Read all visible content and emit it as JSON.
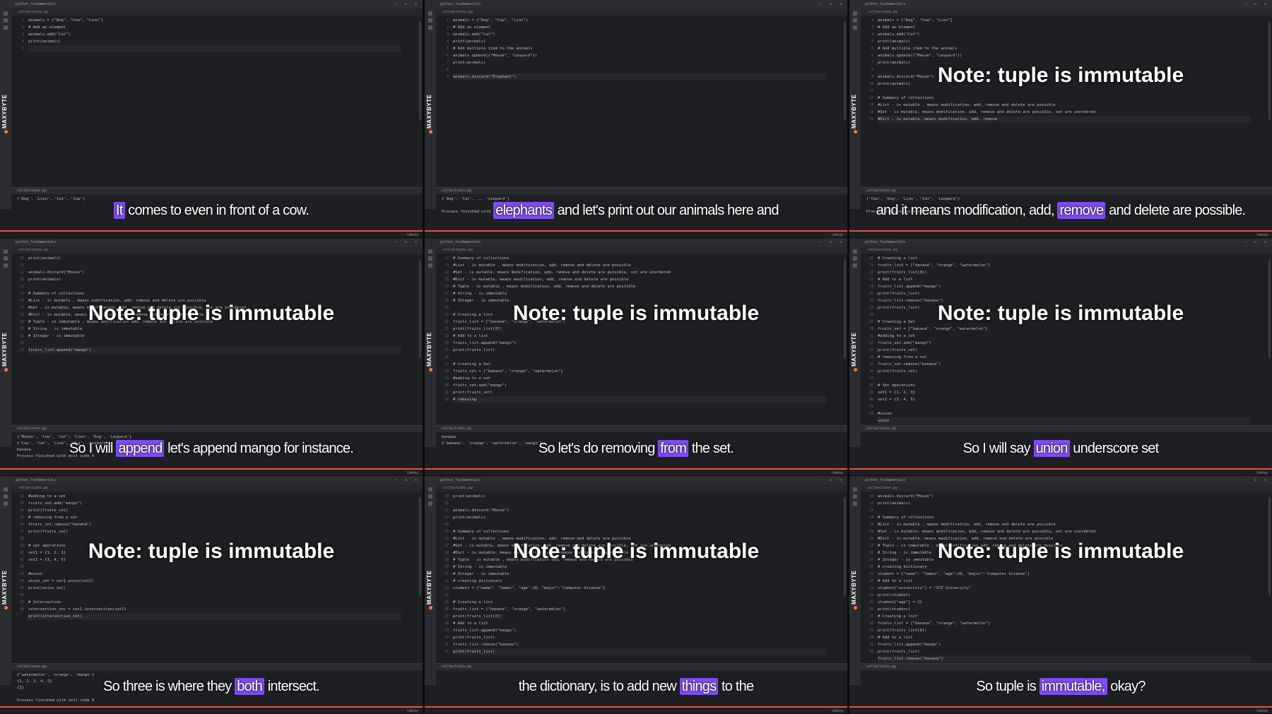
{
  "brand": "MAXYBYTE",
  "footer_label": "Udemy",
  "note_text": "Note: tuple is immutable",
  "panels": [
    {
      "title": "python_fundamentals",
      "tab": "collections.py",
      "gutter": "1\n2\n3\n4\n5",
      "code": [
        "animals = {\"Dog\", \"Cow\", \"Lion\"}",
        "# Add an element",
        "animals.add(\"Cat\")",
        "print(animals)",
        ""
      ],
      "output": "{'Dog', 'Lion', 'Cat', 'Cow'}",
      "note": false,
      "caption": {
        "before": "",
        "hl": "It",
        "after": " comes to even in front of a cow."
      }
    },
    {
      "title": "python_fundamentals",
      "tab": "collections.py",
      "gutter": "1\n2\n3\n4\n5\n6\n7\n8\n9",
      "code": [
        "animals = {\"Dog\", \"Cow\", \"Lion\"}",
        "# Add an element",
        "animals.add(\"Cat\")",
        "print(animals)",
        "# Add multiple item to the animals",
        "animals.update({\"Mouse\", \"Leopard\"})",
        "print(animals)",
        "",
        "animals.discard(\"Elephant\")"
      ],
      "output": "{'Dog', 'Cat', ... 'Leopard'}\n\nProcess finished with exit code 0",
      "note": false,
      "caption": {
        "before": "",
        "hl": "elephants",
        "after": " and let's print out our animals here and"
      }
    },
    {
      "title": "python_fundamentals",
      "tab": "collections.py",
      "gutter": "1\n2\n3\n4\n5\n6\n7\n8\n9\n10\n11\n12\n13\n14\n15",
      "code": [
        "animals = {\"Dog\", \"Cow\", \"Lion\"}",
        "# Add an element",
        "animals.add(\"Cat\")",
        "print(animals)",
        "# Add multiple item to the animals",
        "animals.update({\"Mouse\", \"Leopard\"})",
        "print(animals)",
        "",
        "animals.discard(\"Mouse\")",
        "print(animals)",
        "",
        "# Summary of collections",
        "#List - is mutable , means modification, add, remove and delete are possible",
        "#Set - is mutable, means modification, add, remove and delete are possible, set are unordered",
        "#Dict - is mutable, means modification, add, remove"
      ],
      "output": "{'Cow', 'Dog', 'Lion', 'Cat', 'Leopard'}\n\nProcess finished with exit code 0",
      "note": true,
      "caption": {
        "before": "and it means modification, add, ",
        "hl": "remove",
        "after": " and delete are possible."
      }
    },
    {
      "title": "python_fundamentals",
      "tab": "collections.py",
      "gutter": "10\n11\n12\n13\n14\n15\n16\n17\n18\n19\n20\n21\n22\n23",
      "code": [
        "print(animals)",
        "",
        "animals.discard(\"Mouse\")",
        "print(animals)",
        "",
        "# Summary of collections",
        "#List - is mutable , means modification, add, remove and delete are possible",
        "#Set - is mutable, means modification, add, remove and delete are possible, set are unordered",
        "#Dict - is mutable, means modification, add, remove and delete are possible",
        "# Tuple - is immutable , means modification add, remove and delete are possible",
        "# String - is immutable",
        "# Integer - is immutable",
        "",
        "fruits_list.append(\"mango\")"
      ],
      "output": "{'Mouse', 'Cow', 'Cat', 'Lion', 'Dog', 'Leopard'}\n{'Cow', 'Cat', 'Lion', 'Dog', 'Leopard'}\nbanana\nProcess finished with exit code 0",
      "note": true,
      "caption": {
        "before": "So I will ",
        "hl": "append",
        "after": " let's append mango for instance."
      }
    },
    {
      "title": "python_fundamentals",
      "tab": "collections.py",
      "gutter": "12\n13\n14\n15\n16\n17\n18\n19\n20\n21\n22\n23\n24\n25\n26\n27\n28\n29\n30\n31\n32",
      "code": [
        "# Summary of collections",
        "#List - is mutable , means modification, add, remove and delete are possible",
        "#Set - is mutable, means modification, add, remove and delete are possible, set are unordered",
        "#Dict - is mutable, means modification, add, remove and delete are possible",
        "# Tuple - is mutable , means modification, add, remove and delete are possible",
        "# String - is immutable",
        "# Integer - is immutable",
        "",
        "# Creating a list",
        "fruits_list = [\"banana\", \"orange\", \"watermelon\"]",
        "print(fruits_list[0])",
        "# Add to a list",
        "fruits_list.append(\"mango\")",
        "print(fruits_list)",
        "",
        "# Creating a Set",
        "fruits_set = {\"banana\", \"orange\", \"watermelon\"}",
        "#adding to a set",
        "fruits_set.add(\"mango\")",
        "print(fruits_set)",
        "# removing "
      ],
      "output": "banana\n{'banana', 'orange', 'watermelon', 'mango'}",
      "note": true,
      "caption": {
        "before": "So let's do removing ",
        "hl": "from",
        "after": " the set."
      }
    },
    {
      "title": "python_fundamentals",
      "tab": "collections.py",
      "gutter": "20\n21\n22\n23\n24\n25\n26\n27\n28\n29\n30\n31\n32\n33\n34\n35\n36\n37\n38\n39\n40\n41\n42",
      "code": [
        "# Creating a list",
        "fruits_list = [\"banana\", \"orange\", \"watermelon\"]",
        "print(fruits_list[0])",
        "# Add to a list",
        "fruits_list.append(\"mango\")",
        "print(fruits_list)",
        "fruits_list.remove(\"banana\")",
        "print(fruits_list)",
        "",
        "# Creating a Set",
        "fruits_set = {\"banana\", \"orange\", \"watermelon\"}",
        "#adding to a set",
        "fruits_set.add(\"mango\")",
        "print(fruits_set)",
        "# removing from a set",
        "fruits_set.remove(\"banana\")",
        "print(fruits_set)",
        "",
        "# Set operations",
        "set1 = {1, 2, 3}",
        "set2 = {3, 4, 5}",
        "",
        "#union",
        "union"
      ],
      "output": "",
      "note": true,
      "caption": {
        "before": "So I will say ",
        "hl": "union",
        "after": " underscore set"
      }
    },
    {
      "title": "python_fundamentals",
      "tab": "collections.py",
      "gutter": "32\n33\n34\n35\n36\n37\n38\n39\n40\n41\n42\n43\n44\n45\n46\n47\n48",
      "code": [
        "#adding to a set",
        "fruits_set.add(\"mango\")",
        "print(fruits_set)",
        "# removing from a set",
        "fruits_set.remove(\"banana\")",
        "print(fruits_set)",
        "",
        "# set operations",
        "set1 = {1, 2, 3}",
        "set2 = {3, 4, 5}",
        "",
        "#union",
        "union_set = set1.union(set2)",
        "print(union_set)",
        "",
        "# Intersection",
        "intersection_set = set1.intersection(set2)",
        "print(intersection_set)"
      ],
      "output": "{'watermelon', 'orange', 'mango'}\n{1, 2, 3, 4, 5}\n{3}\n\nProcess finished with exit code 0",
      "note": true,
      "caption": {
        "before": "So three is where they ",
        "hl": "both",
        "after": " intersect."
      }
    },
    {
      "title": "python_fundamentals",
      "tab": "collections.py",
      "gutter": "10\n11\n12\n13\n14\n15\n16\n17\n18\n19\n20\n21\n22\n23\n24\n25\n26\n27\n28\n29\n30\n31\n32",
      "code": [
        "print(animals)",
        "",
        "animals.discard(\"Mouse\")",
        "print(animals)",
        "",
        "# Summary of collections",
        "#List - is mutable , means modification, add, remove and delete are possible",
        "#Set - is mutable, means modification, add, remove and delete are possible, set are unordered",
        "#Dict - is mutable, means modification, add, remove and delete are possible",
        "# Tuple - is mutable , means modification add, remove and delete are possible",
        "# String - is immutable",
        "# Integer - is immutable",
        "# creating dictionary",
        "student = {\"name\": \"James\", \"age\":20, \"major\":\"Computer Science\"}",
        "",
        "# Creating a list",
        "fruits_list = [\"banana\", \"orange\", \"watermelon\"]",
        "print(fruits_list[0])",
        "# Add to a list",
        "fruits_list.append(\"mango\")",
        "print(fruits_list)",
        "fruits_list.remove(\"banana\")",
        "print(fruits_list)"
      ],
      "output": "",
      "note": true,
      "caption": {
        "before": "the dictionary, is to add new ",
        "hl": "things",
        "after": " to the"
      }
    },
    {
      "title": "python_fundamentals",
      "tab": "collections.py",
      "gutter": "10\n11\n12\n13\n14\n15\n16\n17\n18\n19\n20\n21\n22\n23\n24\n25\n26\n27\n28\n29\n30\n31\n32",
      "code": [
        "animals.discard(\"Mouse\")",
        "print(animals)",
        "",
        "# Summary of collections",
        "#List - is mutable , means modification, add, remove and delete are possible",
        "#Set - is mutable, means modification, add, remove and delete are possible, set are unordered",
        "#Dict - is mutable, means modification, add, remove and delete are possible",
        "# Tuple - is immutable , means modification add, remove and delete are possible",
        "# String - is immutable",
        "# Integer - is immutable",
        "# creating dictionary",
        "student = {\"name\": \"James\", \"age\":20, \"major\":\"Computer Science\"}",
        "# Add to a list",
        "student[\"university\"] = \"XYZ University\"",
        "print(student)",
        "student[\"age\"] = 21",
        "print(student)",
        "# Creating a list",
        "fruits_list = [\"banana\", \"orange\", \"watermelon\"]",
        "print(fruits_list[0])",
        "# Add to a list",
        "fruits_list.append(\"mango\")",
        "print(fruits_list)",
        "fruits_list.remove(\"banana\")"
      ],
      "output": "",
      "note": true,
      "caption": {
        "before": "So tuple is ",
        "hl": "immutable,",
        "after": " okay?"
      }
    }
  ]
}
